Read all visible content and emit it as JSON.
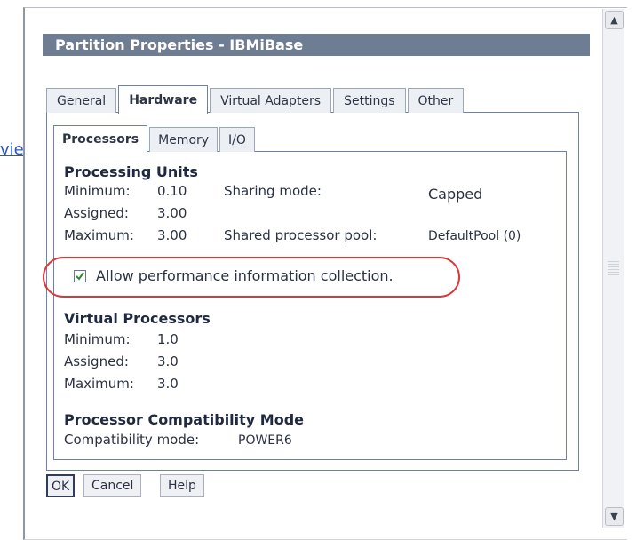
{
  "left_link_text": "vie",
  "dialog": {
    "title": "Partition Properties - IBMiBase",
    "tabs": [
      {
        "label": "General",
        "active": false
      },
      {
        "label": "Hardware",
        "active": true
      },
      {
        "label": "Virtual Adapters",
        "active": false
      },
      {
        "label": "Settings",
        "active": false
      },
      {
        "label": "Other",
        "active": false
      }
    ],
    "subtabs": [
      {
        "label": "Processors",
        "active": true
      },
      {
        "label": "Memory",
        "active": false
      },
      {
        "label": "I/O",
        "active": false
      }
    ],
    "processing_units": {
      "heading": "Processing Units",
      "minimum_label": "Minimum:",
      "minimum_value": "0.10",
      "assigned_label": "Assigned:",
      "assigned_value": "3.00",
      "maximum_label": "Maximum:",
      "maximum_value": "3.00",
      "sharing_mode_label": "Sharing mode:",
      "sharing_mode_value": "Capped",
      "pool_label": "Shared processor pool:",
      "pool_value": "DefaultPool (0)"
    },
    "performance_checkbox": {
      "label": "Allow performance information collection.",
      "checked": true
    },
    "virtual_processors": {
      "heading": "Virtual Processors",
      "minimum_label": "Minimum:",
      "minimum_value": "1.0",
      "assigned_label": "Assigned:",
      "assigned_value": "3.0",
      "maximum_label": "Maximum:",
      "maximum_value": "3.0"
    },
    "compatibility": {
      "heading": "Processor Compatibility Mode",
      "mode_label": "Compatibility mode:",
      "mode_value": "POWER6"
    },
    "buttons": {
      "ok": "OK",
      "cancel": "Cancel",
      "help": "Help"
    }
  },
  "colors": {
    "title_bar": "#6e7d92",
    "highlight_oval": "#d63a3a",
    "tab_border": "#6e80a6"
  }
}
